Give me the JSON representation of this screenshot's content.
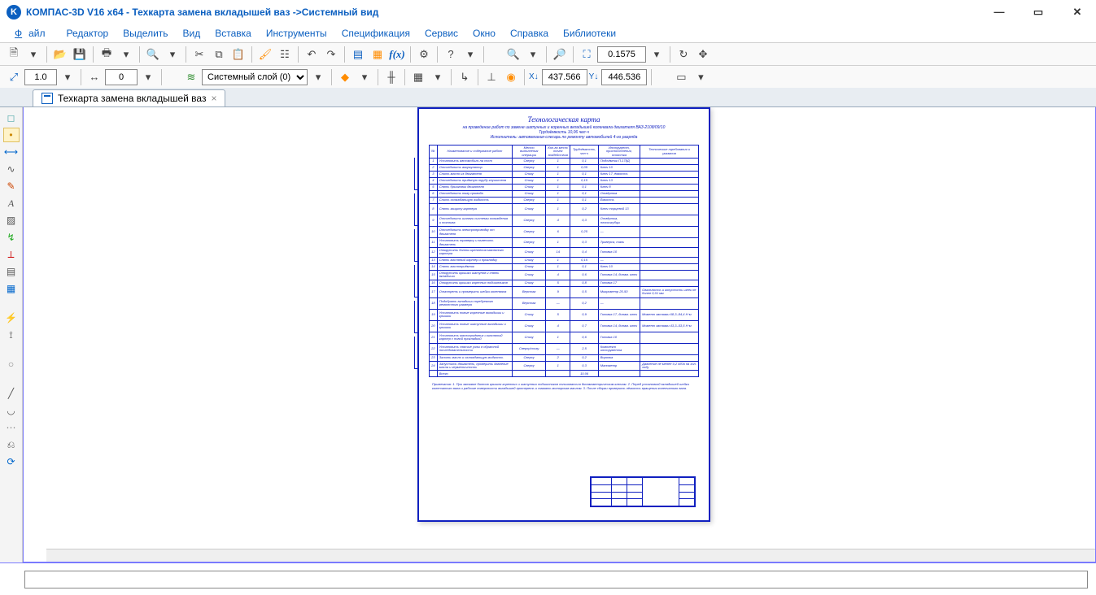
{
  "titlebar": {
    "app": "КОМПАС-3D V16  x64",
    "doc": "Техкарта замена вкладышей ваз",
    "view": "Системный вид"
  },
  "menu": {
    "file": "Файл",
    "edit": "Редактор",
    "select": "Выделить",
    "view": "Вид",
    "insert": "Вставка",
    "tools": "Инструменты",
    "spec": "Спецификация",
    "service": "Сервис",
    "window": "Окно",
    "help": "Справка",
    "libs": "Библиотеки"
  },
  "toolbar1": {
    "zoom_value": "0.1575"
  },
  "toolbar2": {
    "scale": "1.0",
    "step": "0",
    "layer": "Системный слой (0)",
    "coord_x": "437.566",
    "coord_y": "446.536"
  },
  "doctab": {
    "name": "Техкарта замена вкладышей ваз"
  },
  "drawing": {
    "title": "Технологическая карта",
    "sub1": "на проведение работ по замене шатунных и коренных вкладышей коленвала двигателя ВАЗ-2108/09/10",
    "sub2": "Трудоёмкость 10,06 чел·ч",
    "sub3": "Исполнитель: автомеханик-слесарь по ремонту автомобилей 4-го разряда",
    "headers": {
      "num": "№",
      "name": "Наименование и содержание работ",
      "tool": "Место выполнения операции",
      "c3": "Кол-во мест/точек воздействия",
      "c4": "Трудоёмкость, чел·ч",
      "c5": "Инструмент, приспособления, оснастка",
      "c6": "Технические требования и указания"
    },
    "rows": [
      {
        "n": "1",
        "name": "Установить автомобиль на пост",
        "tool": "Сверху",
        "c3": "1",
        "c4": "0,1",
        "c5": "Подъёмник П-178Д",
        "c6": ""
      },
      {
        "n": "2",
        "name": "Отсоединить аккумулятор",
        "tool": "Сверху",
        "c3": "1",
        "c4": "0,05",
        "c5": "Ключ 10",
        "c6": ""
      },
      {
        "n": "3",
        "name": "Слить масло из двигателя",
        "tool": "Снизу",
        "c3": "1",
        "c4": "0,1",
        "c5": "Ключ 17, ёмкость",
        "c6": ""
      },
      {
        "n": "4",
        "name": "Отсоединить приёмную трубу глушителя",
        "tool": "Снизу",
        "c3": "1",
        "c4": "0,15",
        "c5": "Ключ 13",
        "c6": ""
      },
      {
        "n": "5",
        "name": "Снять брызговик двигателя",
        "tool": "Снизу",
        "c3": "1",
        "c4": "0,1",
        "c5": "Ключ 8",
        "c6": ""
      },
      {
        "n": "6",
        "name": "Отсоединить тягу привода",
        "tool": "Снизу",
        "c3": "1",
        "c4": "0,1",
        "c5": "Отвёртка",
        "c6": ""
      },
      {
        "n": "7",
        "name": "Слить охлаждающую жидкость",
        "tool": "Сверху",
        "c3": "1",
        "c4": "0,1",
        "c5": "Ёмкость",
        "c6": ""
      },
      {
        "n": "8",
        "name": "Снять защиту картера",
        "tool": "Снизу",
        "c3": "1",
        "c4": "0,2",
        "c5": "Ключ торцевой 13",
        "c6": "",
        "tall": true
      },
      {
        "n": "9",
        "name": "Отсоединить шланги системы охлаждения и топлива",
        "tool": "Сверху",
        "c3": "4",
        "c4": "0,3",
        "c5": "Отвёртка, плоскогубцы",
        "c6": "",
        "tall": true
      },
      {
        "n": "10",
        "name": "Отсоединить электропроводку от двигателя",
        "tool": "Сверху",
        "c3": "6",
        "c4": "0,25",
        "c5": "—",
        "c6": "",
        "tall": true
      },
      {
        "n": "11",
        "name": "Установить траверсу и вывесить двигатель",
        "tool": "Сверху",
        "c3": "1",
        "c4": "0,3",
        "c5": "Траверса, таль",
        "c6": ""
      },
      {
        "n": "12",
        "name": "Открутить болты крепления масляного картера",
        "tool": "Снизу",
        "c3": "14",
        "c4": "0,4",
        "c5": "Головка 10",
        "c6": ""
      },
      {
        "n": "13",
        "name": "Снять масляный картер и прокладку",
        "tool": "Снизу",
        "c3": "1",
        "c4": "0,15",
        "c5": "—",
        "c6": ""
      },
      {
        "n": "14",
        "name": "Снять маслоприёмник",
        "tool": "Снизу",
        "c3": "1",
        "c4": "0,1",
        "c5": "Ключ 10",
        "c6": ""
      },
      {
        "n": "15",
        "name": "Открутить крышки шатунов и снять вкладыши",
        "tool": "Снизу",
        "c3": "4",
        "c4": "0,6",
        "c5": "Головка 14, динам. ключ",
        "c6": ""
      },
      {
        "n": "16",
        "name": "Открутить крышки коренных подшипников",
        "tool": "Снизу",
        "c3": "5",
        "c4": "0,8",
        "c5": "Головка 17",
        "c6": ""
      },
      {
        "n": "17",
        "name": "Осмотреть и промерить шейки коленвала",
        "tool": "Верстак",
        "c3": "9",
        "c4": "0,5",
        "c5": "Микрометр 25-50",
        "c6": "Овальность и конусность шеек не более 0,01 мм",
        "tall": true
      },
      {
        "n": "18",
        "name": "Подобрать вкладыши требуемого ремонтного размера",
        "tool": "Верстак",
        "c3": "—",
        "c4": "0,2",
        "c5": "—",
        "c6": "",
        "tall": true
      },
      {
        "n": "19",
        "name": "Установить новые коренные вкладыши и крышки",
        "tool": "Снизу",
        "c3": "5",
        "c4": "0,9",
        "c5": "Головка 17, динам. ключ",
        "c6": "Момент затяжки 68,3–84,4 Н·м",
        "tall": true
      },
      {
        "n": "20",
        "name": "Установить новые шатунные вкладыши и крышки",
        "tool": "Снизу",
        "c3": "4",
        "c4": "0,7",
        "c5": "Головка 14, динам. ключ",
        "c6": "Момент затяжки 43,3–53,5 Н·м",
        "tall": true
      },
      {
        "n": "21",
        "name": "Установить маслоприёмник и масляный картер с новой прокладкой",
        "tool": "Снизу",
        "c3": "1",
        "c4": "0,6",
        "c5": "Головка 10",
        "c6": "",
        "tall": true
      },
      {
        "n": "22",
        "name": "Установить снятые узлы в обратной последовательности",
        "tool": "Сверху/снизу",
        "c3": "—",
        "c4": "2,5",
        "c5": "Комплект инструмента",
        "c6": "",
        "tall": true
      },
      {
        "n": "23",
        "name": "Залить масло и охлаждающую жидкость",
        "tool": "Сверху",
        "c3": "2",
        "c4": "0,2",
        "c5": "Воронка",
        "c6": ""
      },
      {
        "n": "24",
        "name": "Запустить двигатель, проверить давление масла и герметичность",
        "tool": "Сверху",
        "c3": "1",
        "c4": "0,3",
        "c5": "Манометр",
        "c6": "Давление не менее 0,2 МПа на хол. ходу"
      },
      {
        "n": "",
        "name": "Всего",
        "tool": "",
        "c3": "",
        "c4": "10,06",
        "c5": "",
        "c6": ""
      }
    ],
    "notes": "Примечания:\n1. При затяжке болтов крышек коренных и шатунных подшипников пользоваться динамометрическим ключом.\n2. Перед установкой вкладышей шейки коленчатого вала и рабочие поверхности вкладышей протереть и смазать моторным маслом.\n3. После сборки проверить лёгкость вращения коленчатого вала."
  },
  "status": {
    "value": ""
  }
}
